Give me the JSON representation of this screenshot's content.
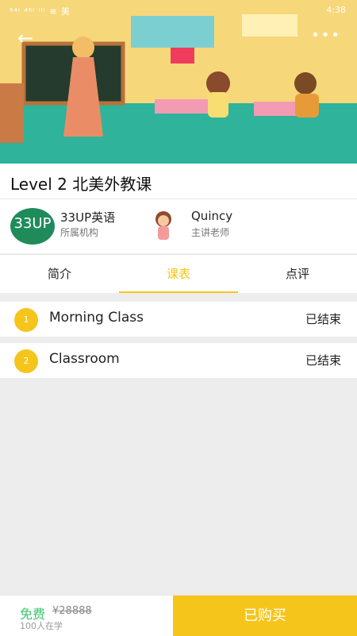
{
  "status": {
    "left": "⁶⁴ᴵ ⁴⁶ᴵ ᴵᴵᴵ ≋ 美",
    "time": "4:38"
  },
  "course": {
    "title": "Level 2 北美外教课"
  },
  "org": {
    "logo_text": "33UP",
    "name": "33UP英语",
    "role": "所属机构"
  },
  "teacher": {
    "name": "Quincy",
    "role": "主讲老师"
  },
  "tabs": [
    {
      "label": "简介"
    },
    {
      "label": "课表"
    },
    {
      "label": "点评"
    }
  ],
  "lessons": [
    {
      "index": "1",
      "name": "Morning Class",
      "status": "已结束"
    },
    {
      "index": "2",
      "name": "Classroom",
      "status": "已结束"
    }
  ],
  "footer": {
    "price": "免费",
    "old_price": "¥28888",
    "count": "100人在学",
    "buy_label": "已购买"
  },
  "colors": {
    "accent": "#f5c51c",
    "free": "#3cc46f"
  }
}
